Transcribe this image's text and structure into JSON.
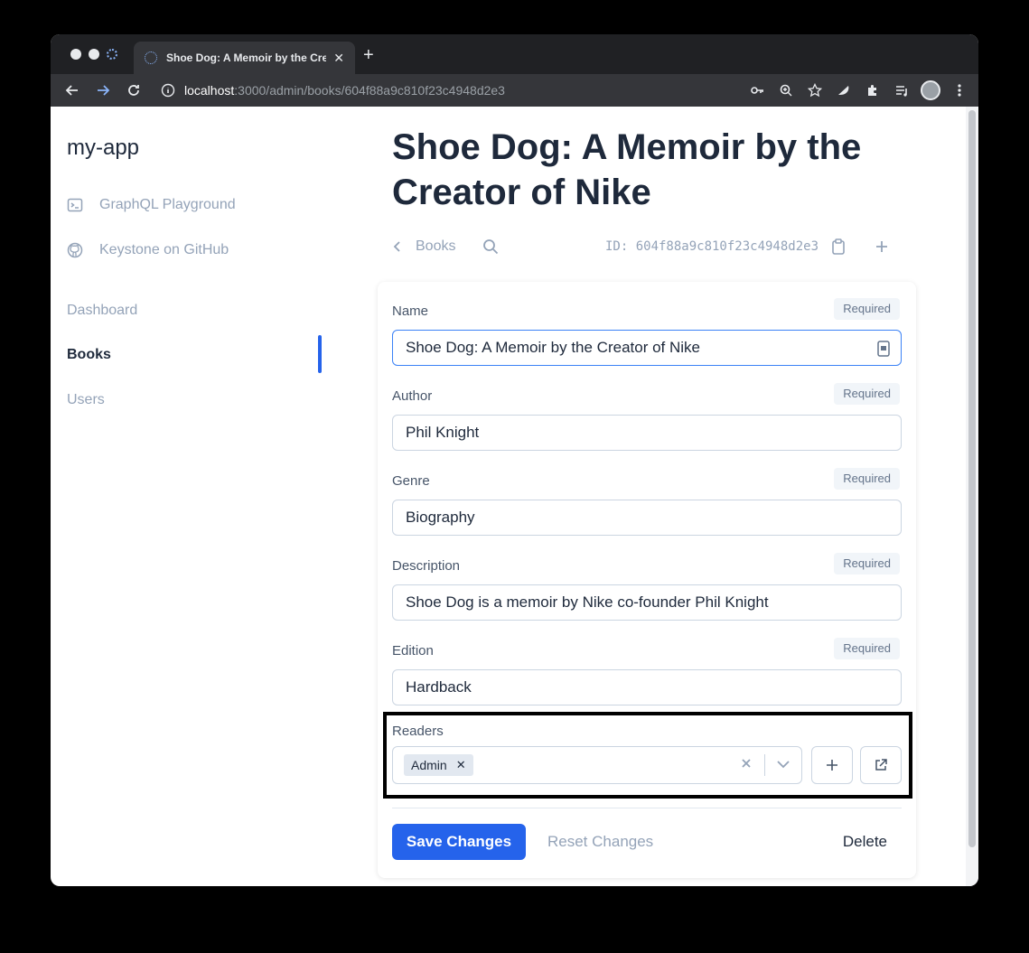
{
  "browser": {
    "tab_title": "Shoe Dog: A Memoir by the Creator of Nike",
    "tab_close": "✕",
    "new_tab": "+",
    "url_host": "localhost",
    "url_path": ":3000/admin/books/604f88a9c810f23c4948d2e3"
  },
  "sidebar": {
    "brand": "my-app",
    "links": [
      {
        "label": "GraphQL Playground",
        "icon": "terminal-icon"
      },
      {
        "label": "Keystone on GitHub",
        "icon": "github-icon"
      }
    ],
    "nav": [
      {
        "label": "Dashboard",
        "active": false
      },
      {
        "label": "Books",
        "active": true
      },
      {
        "label": "Users",
        "active": false
      }
    ]
  },
  "header": {
    "title": "Shoe Dog: A Memoir by the Creator of Nike",
    "breadcrumb": "Books",
    "id_label": "ID: 604f88a9c810f23c4948d2e3"
  },
  "form": {
    "required_label": "Required",
    "fields": [
      {
        "label": "Name",
        "value": "Shoe Dog: A Memoir by the Creator of Nike"
      },
      {
        "label": "Author",
        "value": "Phil Knight"
      },
      {
        "label": "Genre",
        "value": "Biography"
      },
      {
        "label": "Description",
        "value": "Shoe Dog is a memoir by Nike co-founder Phil Knight"
      },
      {
        "label": "Edition",
        "value": "Hardback"
      }
    ],
    "readers": {
      "label": "Readers",
      "selected": "Admin",
      "chip_remove": "✕"
    },
    "save_label": "Save Changes",
    "reset_label": "Reset Changes",
    "delete_label": "Delete"
  },
  "colors": {
    "accent": "#2563eb",
    "text": "#1e293b",
    "muted": "#94a3b8"
  }
}
